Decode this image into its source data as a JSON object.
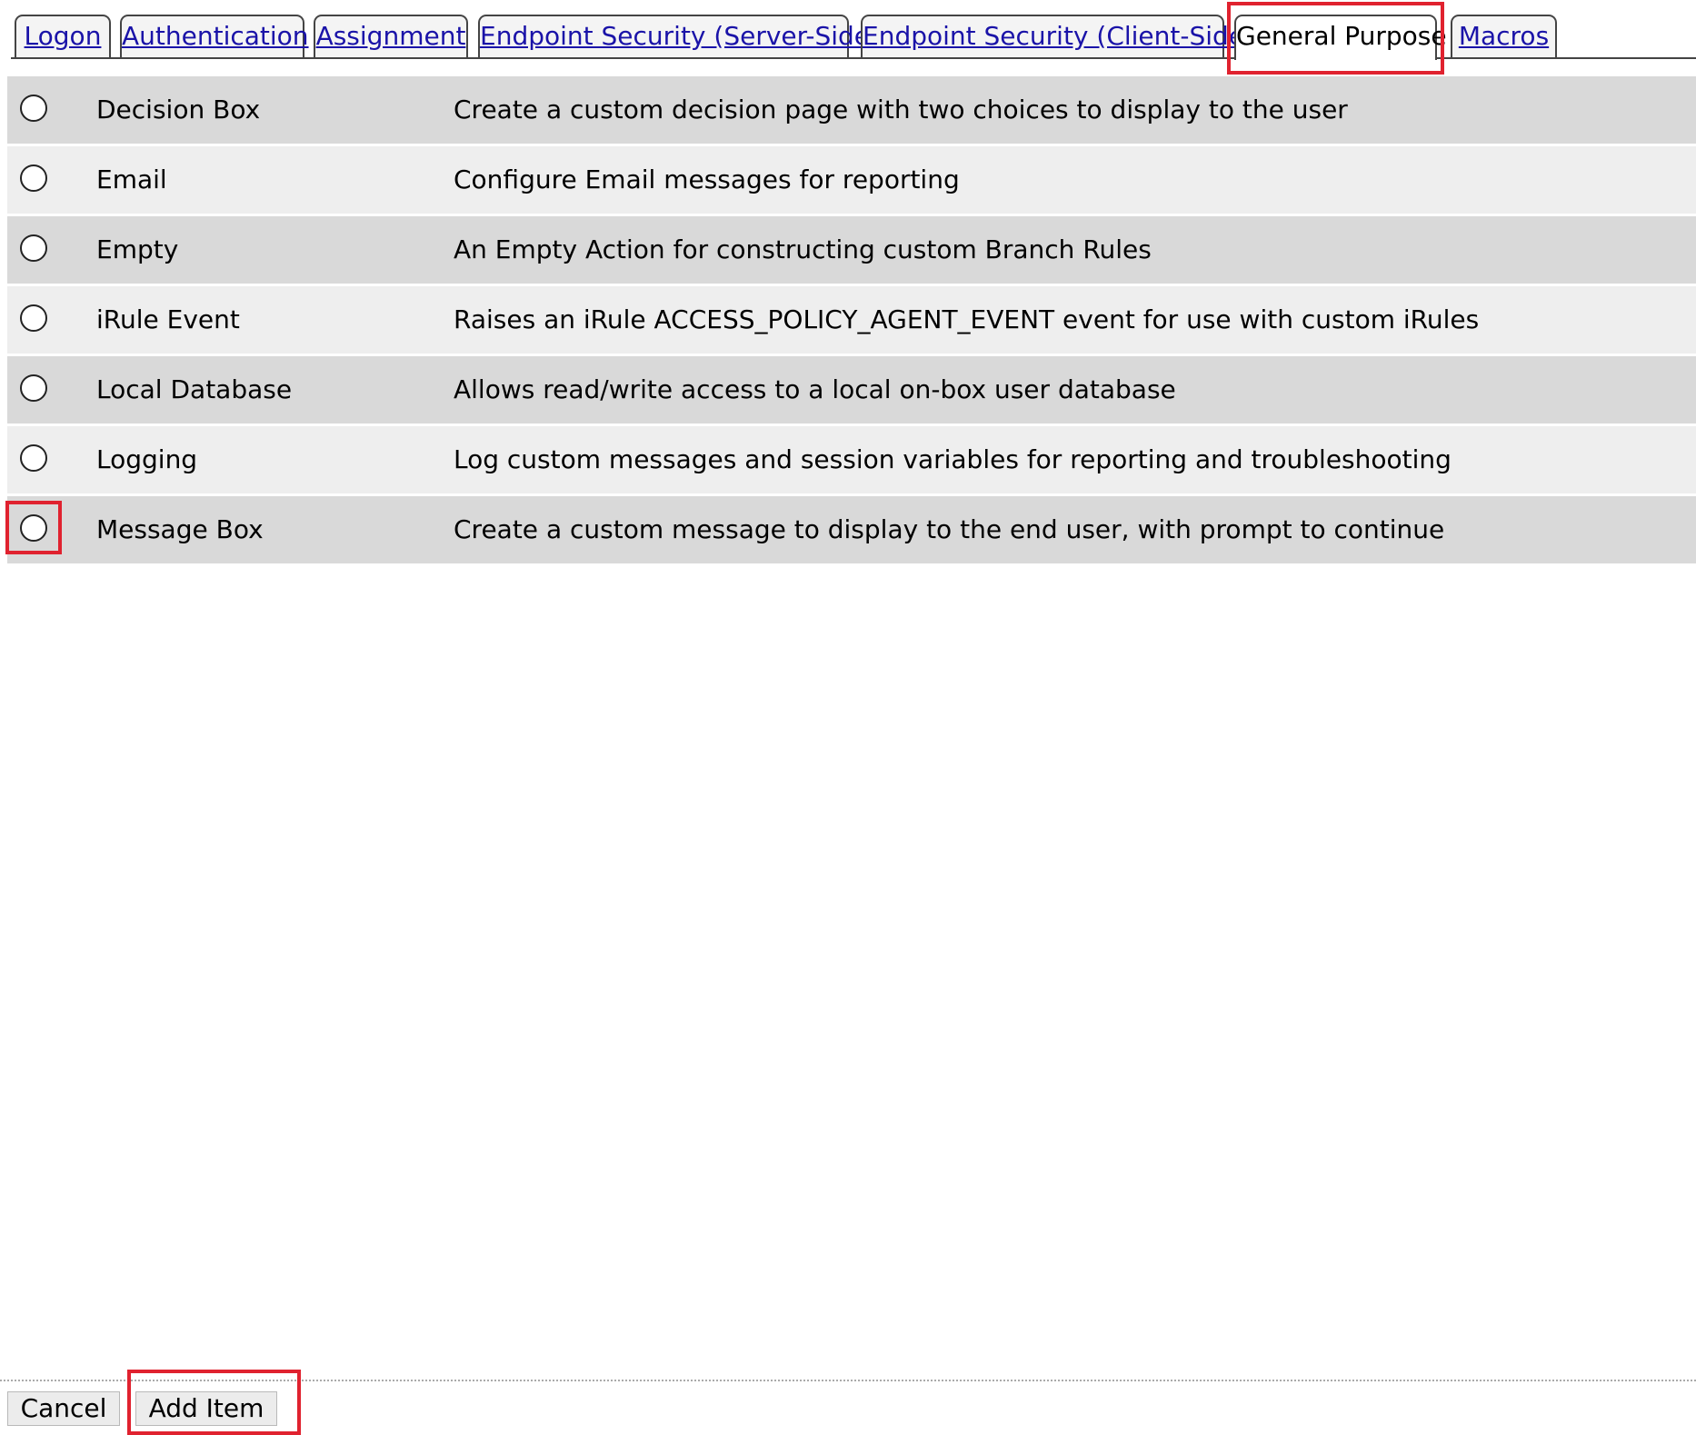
{
  "tabs": [
    {
      "label": "Logon",
      "active": false
    },
    {
      "label": "Authentication",
      "active": false
    },
    {
      "label": "Assignment",
      "active": false
    },
    {
      "label": "Endpoint Security (Server-Side)",
      "active": false
    },
    {
      "label": "Endpoint Security (Client-Side)",
      "active": false
    },
    {
      "label": "General Purpose",
      "active": true
    },
    {
      "label": "Macros",
      "active": false
    }
  ],
  "items": [
    {
      "name": "Decision Box",
      "description": "Create a custom decision page with two choices to display to the user"
    },
    {
      "name": "Email",
      "description": "Configure Email messages for reporting"
    },
    {
      "name": "Empty",
      "description": "An Empty Action for constructing custom Branch Rules"
    },
    {
      "name": "iRule Event",
      "description": "Raises an iRule ACCESS_POLICY_AGENT_EVENT event for use with custom iRules"
    },
    {
      "name": "Local Database",
      "description": "Allows read/write access to a local on-box user database"
    },
    {
      "name": "Logging",
      "description": "Log custom messages and session variables for reporting and troubleshooting"
    },
    {
      "name": "Message Box",
      "description": "Create a custom message to display to the end user, with prompt to continue"
    }
  ],
  "footer": {
    "cancel_label": "Cancel",
    "add_item_label": "Add Item"
  },
  "colors": {
    "highlight": "#e0222f",
    "link": "#1a13a8",
    "row_dark": "#d9d9d9",
    "row_light": "#eeeeee"
  }
}
